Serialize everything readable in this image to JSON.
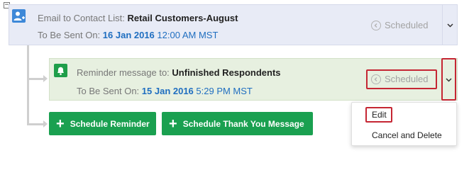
{
  "email": {
    "prefix": "Email to Contact List: ",
    "list_name": "Retail Customers-August",
    "send_prefix": "To Be Sent On: ",
    "send_date": "16 Jan 2016",
    "send_time": " 12:00 AM MST",
    "status": "Scheduled"
  },
  "reminder": {
    "prefix": "Reminder message to: ",
    "target": "Unfinished Respondents",
    "send_prefix": "To Be Sent On: ",
    "send_date": "15 Jan 2016",
    "send_time": " 5:29 PM MST",
    "status": "Scheduled"
  },
  "buttons": {
    "schedule_reminder": "Schedule Reminder",
    "schedule_thank_you": "Schedule Thank You Message"
  },
  "menu": {
    "edit": "Edit",
    "cancel_delete": "Cancel and Delete"
  },
  "tree": {
    "toggle_symbol": "−"
  },
  "colors": {
    "email_bg": "#e8ebf6",
    "reminder_bg": "#e7f0e0",
    "accent_blue": "#1f6ec0",
    "green": "#1aa050",
    "highlight_red": "#c52633"
  },
  "icons": {
    "email": "add-contact-icon",
    "reminder": "bell-icon",
    "status": "clock-icon",
    "dropdown": "chevron-down-icon",
    "add": "plus-icon"
  }
}
